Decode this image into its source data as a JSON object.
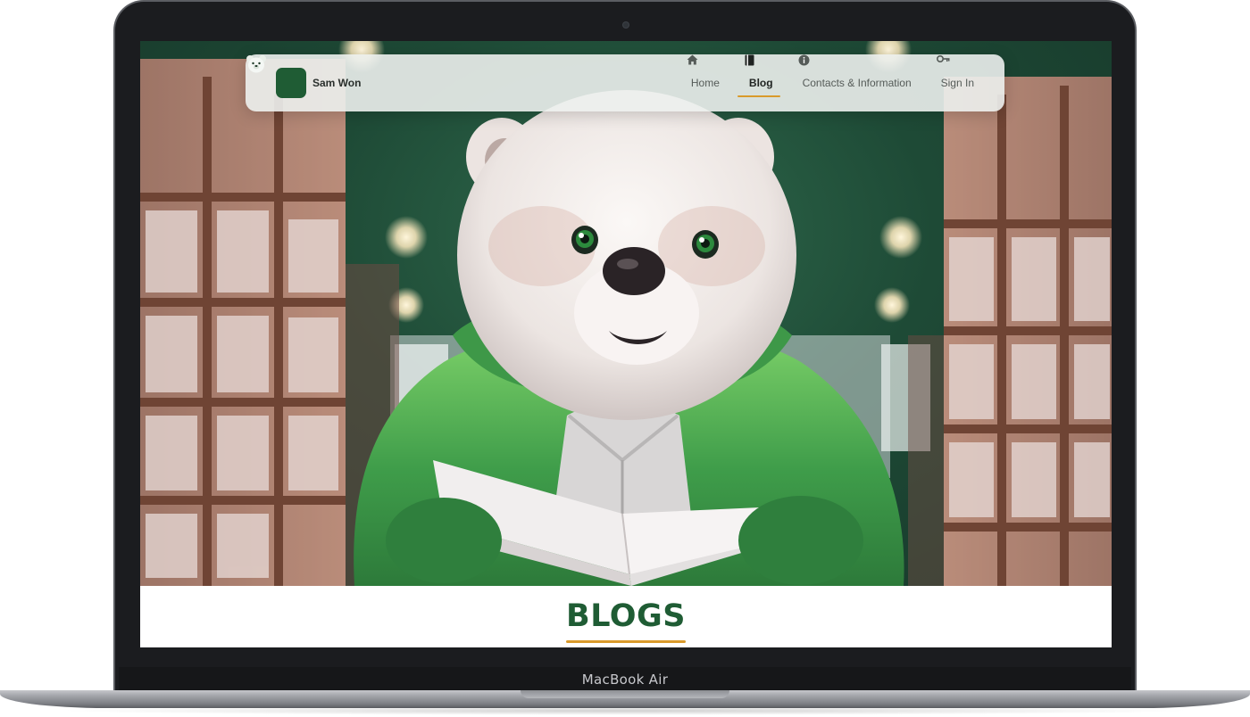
{
  "device": {
    "label": "MacBook Air"
  },
  "navbar": {
    "brand": {
      "name": "Sam Won",
      "logo_icon": "bear-face-icon"
    },
    "links": [
      {
        "label": "Home",
        "icon": "home-icon",
        "active": false
      },
      {
        "label": "Blog",
        "icon": "book-icon",
        "active": true
      },
      {
        "label": "Contacts & Information",
        "icon": "info-icon",
        "active": false
      },
      {
        "label": "Sign In",
        "icon": "key-icon",
        "active": false
      }
    ]
  },
  "hero": {
    "image": "polar bear in green hoodie reading a book in a library"
  },
  "section": {
    "title": "BLOGS"
  },
  "colors": {
    "brand_green": "#1f5c34",
    "accent_gold": "#d99a2b",
    "hero_green": "#1e4a36"
  }
}
